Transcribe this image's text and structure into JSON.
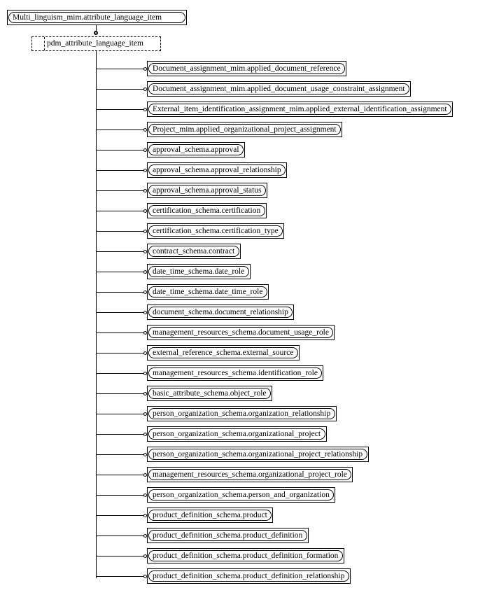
{
  "root": {
    "label": "Multi_linguism_mim.attribute_language_item"
  },
  "select": {
    "label": "pdm_attribute_language_item"
  },
  "items": [
    {
      "label": "Document_assignment_mim.applied_document_reference"
    },
    {
      "label": "Document_assignment_mim.applied_document_usage_constraint_assignment"
    },
    {
      "label": "External_item_identification_assignment_mim.applied_external_identification_assignment"
    },
    {
      "label": "Project_mim.applied_organizational_project_assignment"
    },
    {
      "label": "approval_schema.approval"
    },
    {
      "label": "approval_schema.approval_relationship"
    },
    {
      "label": "approval_schema.approval_status"
    },
    {
      "label": "certification_schema.certification"
    },
    {
      "label": "certification_schema.certification_type"
    },
    {
      "label": "contract_schema.contract"
    },
    {
      "label": "date_time_schema.date_role"
    },
    {
      "label": "date_time_schema.date_time_role"
    },
    {
      "label": "document_schema.document_relationship"
    },
    {
      "label": "management_resources_schema.document_usage_role"
    },
    {
      "label": "external_reference_schema.external_source"
    },
    {
      "label": "management_resources_schema.identification_role"
    },
    {
      "label": "basic_attribute_schema.object_role"
    },
    {
      "label": "person_organization_schema.organization_relationship"
    },
    {
      "label": "person_organization_schema.organizational_project"
    },
    {
      "label": "person_organization_schema.organizational_project_relationship"
    },
    {
      "label": "management_resources_schema.organizational_project_role"
    },
    {
      "label": "person_organization_schema.person_and_organization"
    },
    {
      "label": "product_definition_schema.product"
    },
    {
      "label": "product_definition_schema.product_definition"
    },
    {
      "label": "product_definition_schema.product_definition_formation"
    },
    {
      "label": "product_definition_schema.product_definition_relationship"
    }
  ]
}
